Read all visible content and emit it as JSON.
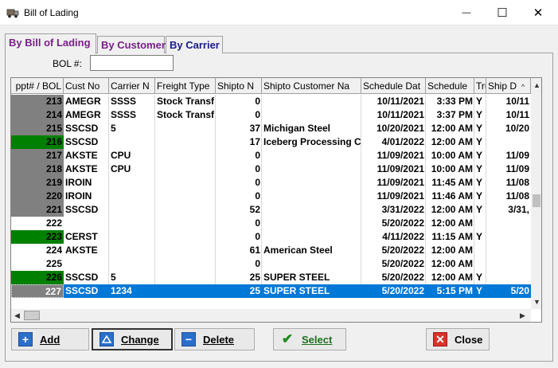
{
  "window": {
    "title": "Bill of Lading",
    "minimize_glyph": "—",
    "maximize_glyph": "☐",
    "close_glyph": "✕"
  },
  "tabs": [
    {
      "label": "By Bill of Lading",
      "active": true
    },
    {
      "label": "By Customer",
      "active": false
    },
    {
      "label": "By Carrier",
      "active": false
    }
  ],
  "bol_filter": {
    "label": "BOL #:",
    "value": ""
  },
  "grid": {
    "columns": [
      "ppt# / BOL",
      "Cust No",
      "Carrier N",
      "Freight Type",
      "Shipto N",
      "Shipto Customer Na",
      "Schedule Dat",
      "Schedule",
      "Tru",
      "Ship D"
    ],
    "rows": [
      {
        "bol": "213",
        "cust": "AMEGR",
        "carrier": "SSSS",
        "freight": "Stock Transf",
        "shipto_n": "0",
        "shipto_name": "",
        "sched_date": "10/11/2021",
        "sched_time": "3:33 PM",
        "tru": "Y",
        "ship_d": "10/11",
        "marker": "gray"
      },
      {
        "bol": "214",
        "cust": "AMEGR",
        "carrier": "SSSS",
        "freight": "Stock Transf",
        "shipto_n": "0",
        "shipto_name": "",
        "sched_date": "10/11/2021",
        "sched_time": "3:37 PM",
        "tru": "Y",
        "ship_d": "10/11",
        "marker": "gray"
      },
      {
        "bol": "215",
        "cust": "SSCSD",
        "carrier": "5",
        "freight": "",
        "shipto_n": "37",
        "shipto_name": "Michigan Steel",
        "sched_date": "10/20/2021",
        "sched_time": "12:00 AM",
        "tru": "Y",
        "ship_d": "10/20",
        "marker": "gray"
      },
      {
        "bol": "216",
        "cust": "SSCSD",
        "carrier": "",
        "freight": "",
        "shipto_n": "17",
        "shipto_name": "Iceberg Processing C",
        "sched_date": "4/01/2022",
        "sched_time": "12:00 AM",
        "tru": "Y",
        "ship_d": "",
        "marker": "green"
      },
      {
        "bol": "217",
        "cust": "AKSTE",
        "carrier": "CPU",
        "freight": "",
        "shipto_n": "0",
        "shipto_name": "",
        "sched_date": "11/09/2021",
        "sched_time": "10:00 AM",
        "tru": "Y",
        "ship_d": "11/09",
        "marker": "gray"
      },
      {
        "bol": "218",
        "cust": "AKSTE",
        "carrier": "CPU",
        "freight": "",
        "shipto_n": "0",
        "shipto_name": "",
        "sched_date": "11/09/2021",
        "sched_time": "10:00 AM",
        "tru": "Y",
        "ship_d": "11/09",
        "marker": "gray"
      },
      {
        "bol": "219",
        "cust": "IROIN",
        "carrier": "",
        "freight": "",
        "shipto_n": "0",
        "shipto_name": "",
        "sched_date": "11/09/2021",
        "sched_time": "11:45 AM",
        "tru": "Y",
        "ship_d": "11/08",
        "marker": "gray"
      },
      {
        "bol": "220",
        "cust": "IROIN",
        "carrier": "",
        "freight": "",
        "shipto_n": "0",
        "shipto_name": "",
        "sched_date": "11/09/2021",
        "sched_time": "11:46 AM",
        "tru": "Y",
        "ship_d": "11/08",
        "marker": "gray"
      },
      {
        "bol": "221",
        "cust": "SSCSD",
        "carrier": "",
        "freight": "",
        "shipto_n": "52",
        "shipto_name": "",
        "sched_date": "3/31/2022",
        "sched_time": "12:00 AM",
        "tru": "Y",
        "ship_d": "3/31,",
        "marker": "gray"
      },
      {
        "bol": "222",
        "cust": "",
        "carrier": "",
        "freight": "",
        "shipto_n": "0",
        "shipto_name": "",
        "sched_date": "5/20/2022",
        "sched_time": "12:00 AM",
        "tru": "",
        "ship_d": "",
        "marker": "white"
      },
      {
        "bol": "223",
        "cust": "CERST",
        "carrier": "",
        "freight": "",
        "shipto_n": "0",
        "shipto_name": "",
        "sched_date": "4/11/2022",
        "sched_time": "11:15 AM",
        "tru": "Y",
        "ship_d": "",
        "marker": "green"
      },
      {
        "bol": "224",
        "cust": "AKSTE",
        "carrier": "",
        "freight": "",
        "shipto_n": "61",
        "shipto_name": "American Steel",
        "sched_date": "5/20/2022",
        "sched_time": "12:00 AM",
        "tru": "",
        "ship_d": "",
        "marker": "white"
      },
      {
        "bol": "225",
        "cust": "",
        "carrier": "",
        "freight": "",
        "shipto_n": "0",
        "shipto_name": "",
        "sched_date": "5/20/2022",
        "sched_time": "12:00 AM",
        "tru": "",
        "ship_d": "",
        "marker": "white"
      },
      {
        "bol": "226",
        "cust": "SSCSD",
        "carrier": "5",
        "freight": "",
        "shipto_n": "25",
        "shipto_name": "SUPER STEEL",
        "sched_date": "5/20/2022",
        "sched_time": "12:00 AM",
        "tru": "Y",
        "ship_d": "",
        "marker": "green"
      },
      {
        "bol": "227",
        "cust": "SSCSD",
        "carrier": "1234",
        "freight": "",
        "shipto_n": "25",
        "shipto_name": "SUPER STEEL",
        "sched_date": "5/20/2022",
        "sched_time": "5:15 PM",
        "tru": "Y",
        "ship_d": "5/20",
        "marker": "gray",
        "selected": true
      }
    ]
  },
  "buttons": {
    "add": "Add",
    "change": "Change",
    "delete": "Delete",
    "select": "Select",
    "close": "Close"
  },
  "colors": {
    "marker_gray": "#808080",
    "marker_green": "#008000",
    "selection": "#0078d7"
  }
}
